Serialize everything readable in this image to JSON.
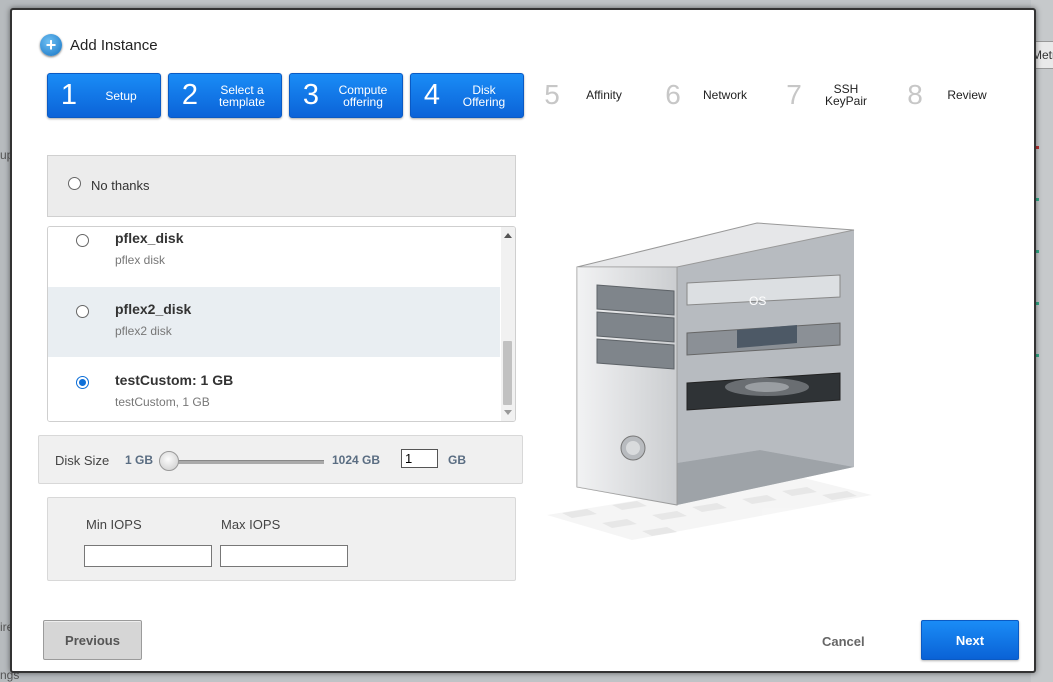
{
  "background": {
    "fragments": [
      "ups",
      "ire",
      "ngs"
    ],
    "right_button": "Metric"
  },
  "dialog": {
    "title": "Add Instance",
    "title_icon": "plus-circle-icon"
  },
  "steps": [
    {
      "num": "1",
      "label": "Setup",
      "active": true
    },
    {
      "num": "2",
      "label": "Select a template",
      "active": true
    },
    {
      "num": "3",
      "label": "Compute offering",
      "active": true
    },
    {
      "num": "4",
      "label": "Disk Offering",
      "active": true
    },
    {
      "num": "5",
      "label": "Affinity",
      "active": false
    },
    {
      "num": "6",
      "label": "Network",
      "active": false
    },
    {
      "num": "7",
      "label": "SSH KeyPair",
      "active": false
    },
    {
      "num": "8",
      "label": "Review",
      "active": false
    }
  ],
  "no_thanks": {
    "label": "No thanks",
    "selected": false
  },
  "offerings": [
    {
      "name": "pflex_disk",
      "desc": "pflex  disk",
      "selected": false
    },
    {
      "name": "pflex2_disk",
      "desc": "pflex2 disk",
      "selected": false
    },
    {
      "name": "testCustom: 1 GB",
      "desc": "testCustom, 1 GB",
      "selected": true
    }
  ],
  "disk_size": {
    "label": "Disk Size",
    "min": "1 GB",
    "max": "1024 GB",
    "value": "1",
    "unit": "GB"
  },
  "iops": {
    "min_label": "Min IOPS",
    "max_label": "Max IOPS",
    "min_value": "",
    "max_value": ""
  },
  "illustration": {
    "os_label": "OS"
  },
  "buttons": {
    "previous": "Previous",
    "cancel": "Cancel",
    "next": "Next"
  },
  "colors": {
    "accent": "#0b63d8",
    "active_step": "#1a8cf6"
  }
}
